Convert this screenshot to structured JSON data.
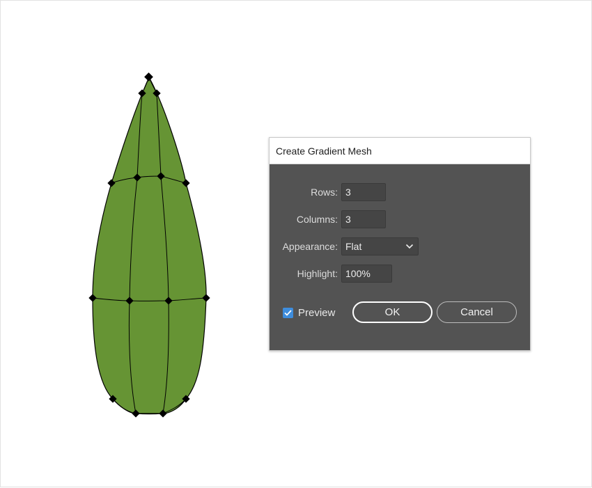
{
  "dialog": {
    "title": "Create Gradient Mesh",
    "rows": {
      "label": "Rows:",
      "value": "3"
    },
    "columns": {
      "label": "Columns:",
      "value": "3"
    },
    "appearance": {
      "label": "Appearance:",
      "value": "Flat"
    },
    "highlight": {
      "label": "Highlight:",
      "value": "100%"
    },
    "preview": {
      "label": "Preview",
      "checked": true
    },
    "ok_label": "OK",
    "cancel_label": "Cancel"
  },
  "artwork": {
    "shape": "leaf",
    "fill_color": "#669434",
    "mesh_rows": 3,
    "mesh_columns": 3
  },
  "colors": {
    "dialog_bg": "#535353",
    "field_bg": "#454545",
    "checkbox_accent": "#3e8ddd"
  }
}
